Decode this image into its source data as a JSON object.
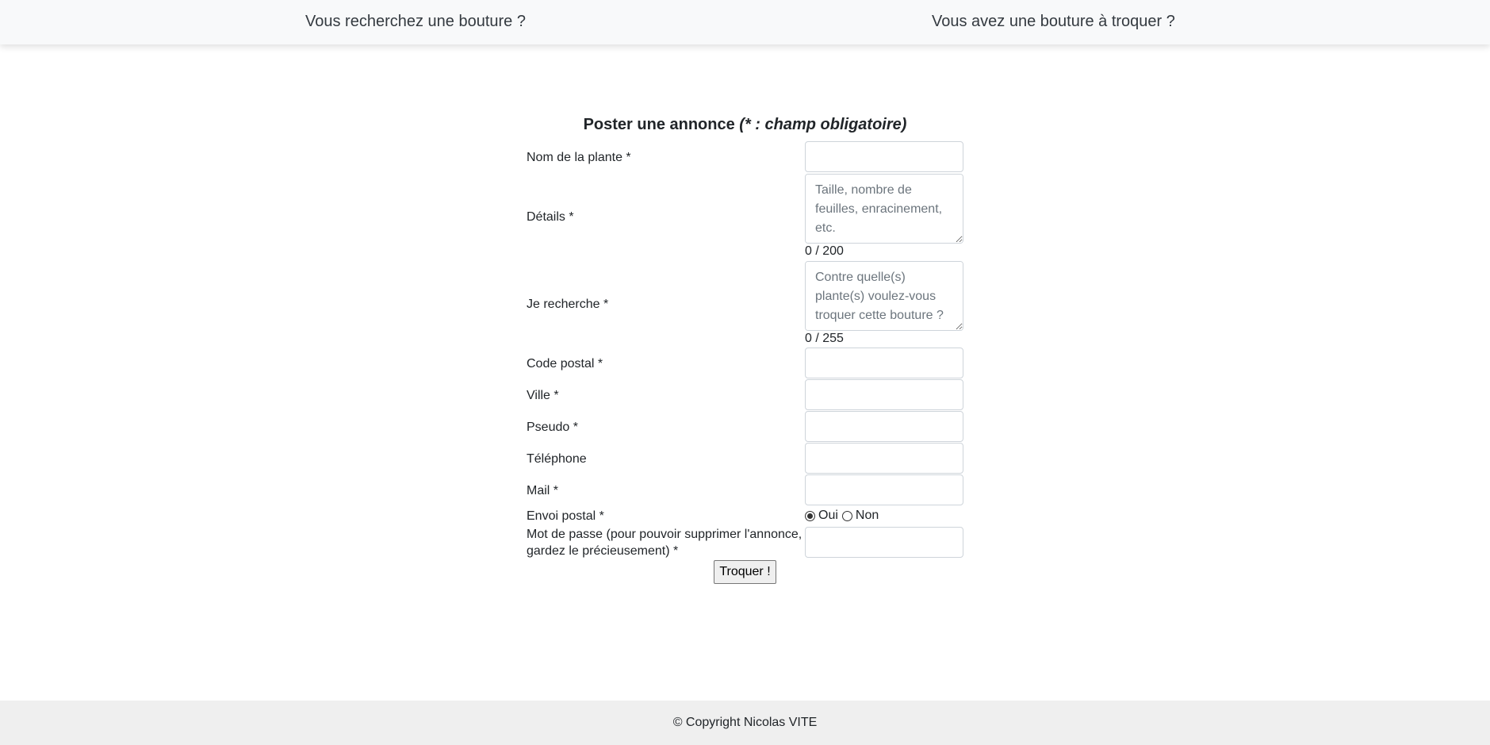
{
  "nav": {
    "search_link": "Vous recherchez une bouture ?",
    "offer_link": "Vous avez une bouture à troquer ?"
  },
  "form": {
    "title": "Poster une annonce",
    "title_note": "(* : champ obligatoire)",
    "plant_name_label": "Nom de la plante *",
    "details_label": "Détails *",
    "details_placeholder": "Taille, nombre de feuilles, enracinement, etc.",
    "details_counter": "0 / 200",
    "wanted_label": "Je recherche *",
    "wanted_placeholder": "Contre quelle(s) plante(s) voulez-vous troquer cette bouture ?",
    "wanted_counter": "0 / 255",
    "postal_code_label": "Code postal *",
    "city_label": "Ville *",
    "pseudo_label": "Pseudo *",
    "phone_label": "Téléphone",
    "mail_label": "Mail *",
    "shipping_label": "Envoi postal *",
    "shipping_options": [
      "Oui",
      "Non"
    ],
    "shipping_selected": "Oui",
    "password_label": "Mot de passe (pour pouvoir supprimer l'annonce, gardez le précieusement) *",
    "submit_label": "Troquer !"
  },
  "footer": {
    "copyright": "© Copyright Nicolas VITE"
  }
}
